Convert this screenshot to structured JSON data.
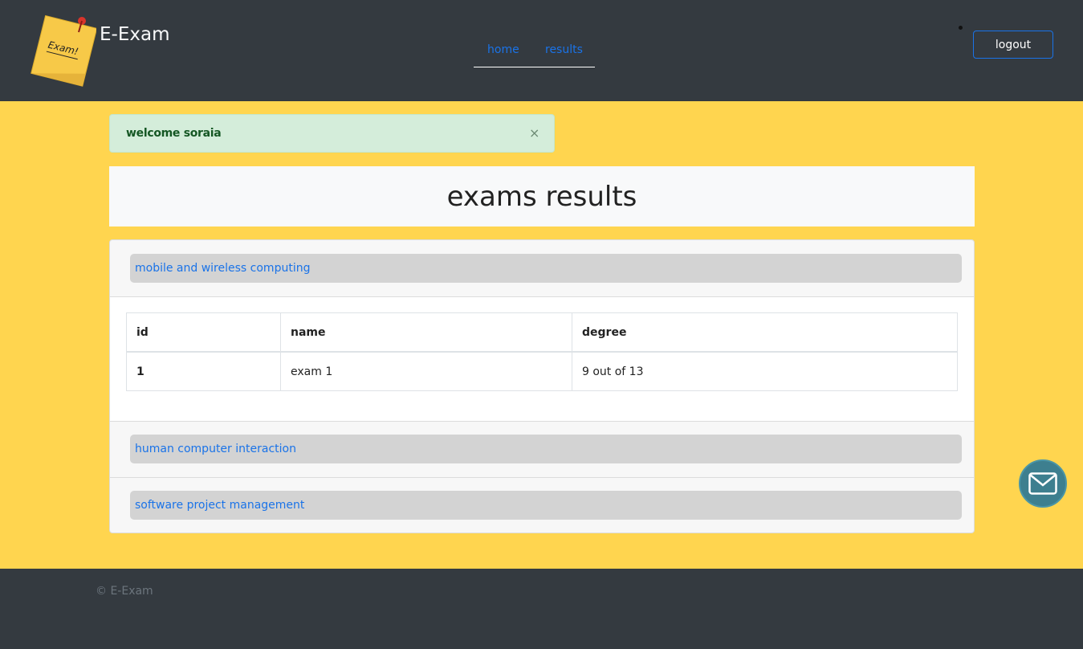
{
  "header": {
    "brand": "E-Exam",
    "logo_text": "Exam!",
    "nav": [
      {
        "label": "home"
      },
      {
        "label": "results"
      }
    ],
    "logout_label": "logout"
  },
  "alert": {
    "message": "welcome soraia",
    "close_symbol": "×"
  },
  "page": {
    "title": "exams results"
  },
  "courses": [
    {
      "name": "mobile and wireless computing",
      "expanded": true,
      "table": {
        "headers": [
          "id",
          "name",
          "degree"
        ],
        "rows": [
          [
            "1",
            "exam 1",
            "9 out of 13"
          ]
        ]
      }
    },
    {
      "name": "human computer interaction",
      "expanded": false
    },
    {
      "name": "software project management",
      "expanded": false
    }
  ],
  "footer": {
    "copyright": "© E-Exam"
  },
  "icons": {
    "logo": "exam-sticky-note-icon",
    "mail": "envelope-icon"
  },
  "colors": {
    "header_bg": "#343a40",
    "main_bg": "#ffd54f",
    "link": "#1a73e8",
    "alert_bg": "#d4edda",
    "mail_button": "#3d7f8f"
  }
}
